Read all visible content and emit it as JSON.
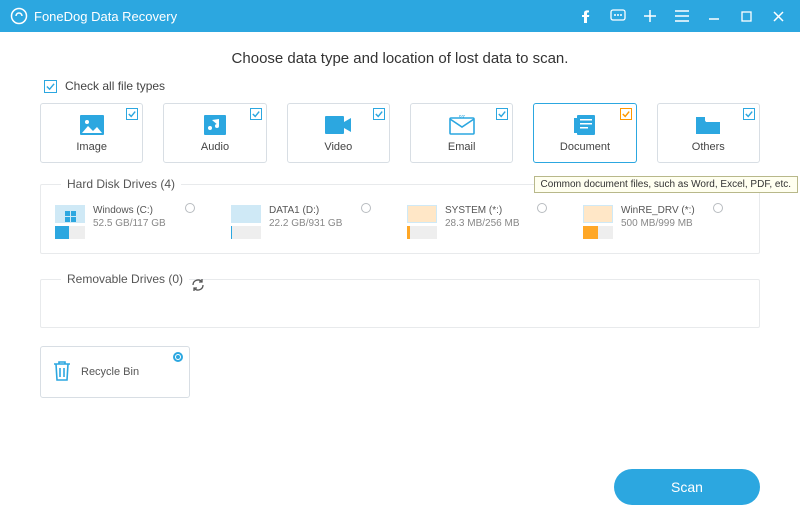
{
  "titlebar": {
    "app_name": "FoneDog Data Recovery"
  },
  "headline": "Choose data type and location of lost data to scan.",
  "checkall_label": "Check all file types",
  "types": {
    "image": "Image",
    "audio": "Audio",
    "video": "Video",
    "email": "Email",
    "document": "Document",
    "others": "Others"
  },
  "tooltip": "Common document files, such as Word, Excel, PDF, etc.",
  "sections": {
    "hdd": "Hard Disk Drives (4)",
    "removable": "Removable Drives (0)"
  },
  "drives": [
    {
      "name": "Windows (C:)",
      "size": "52.5 GB/117 GB",
      "fill": 45,
      "color": "b"
    },
    {
      "name": "DATA1 (D:)",
      "size": "22.2 GB/931 GB",
      "fill": 3,
      "color": "b"
    },
    {
      "name": "SYSTEM (*:)",
      "size": "28.3 MB/256 MB",
      "fill": 11,
      "color": "o"
    },
    {
      "name": "WinRE_DRV (*:)",
      "size": "500 MB/999 MB",
      "fill": 50,
      "color": "o"
    }
  ],
  "recycle": {
    "label": "Recycle Bin"
  },
  "scan_label": "Scan"
}
